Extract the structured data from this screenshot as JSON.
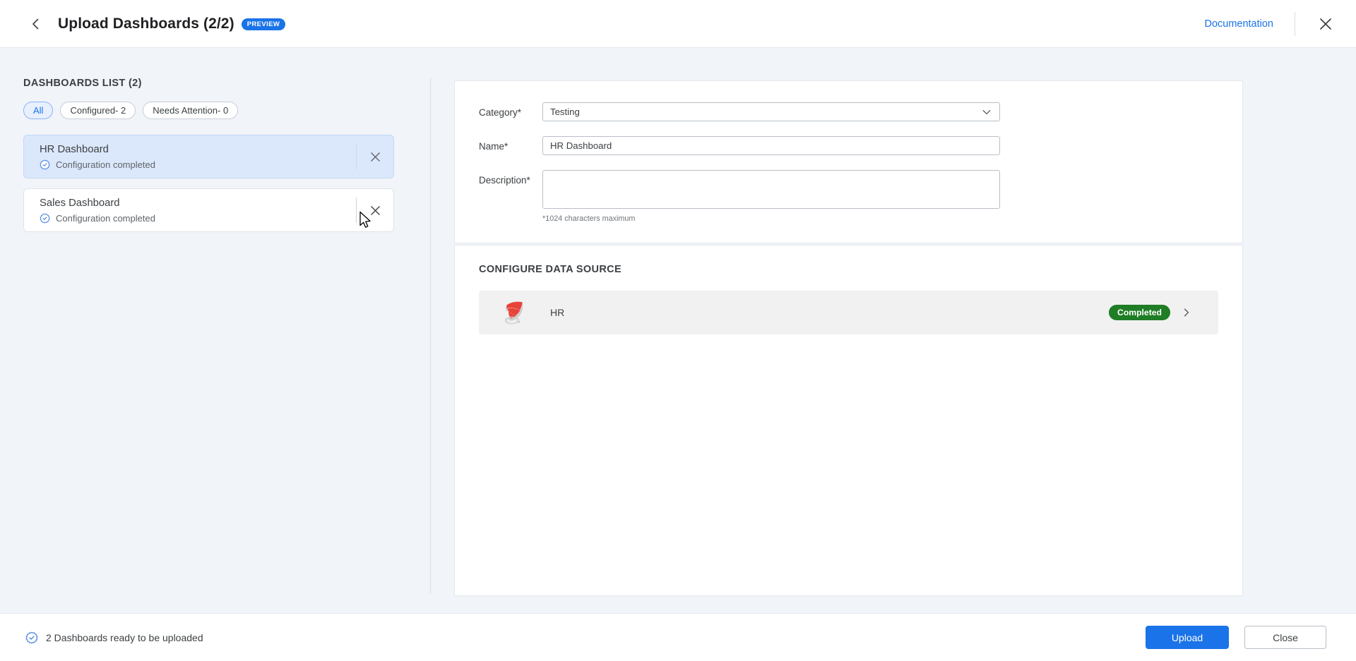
{
  "header": {
    "back_icon": "chevron-left-icon",
    "title": "Upload Dashboards (2/2)",
    "badge": "PREVIEW",
    "documentation_link": "Documentation",
    "close_icon": "close-icon"
  },
  "left": {
    "list_title": "DASHBOARDS LIST (2)",
    "filters": [
      {
        "label": "All",
        "active": true
      },
      {
        "label": "Configured- 2",
        "active": false
      },
      {
        "label": "Needs Attention- 0",
        "active": false
      }
    ],
    "dashboards": [
      {
        "name": "HR Dashboard",
        "status": "Configuration completed",
        "status_icon": "gear-check-icon",
        "remove_icon": "close-icon",
        "selected": true
      },
      {
        "name": "Sales Dashboard",
        "status": "Configuration completed",
        "status_icon": "gear-check-icon",
        "remove_icon": "close-icon",
        "selected": false
      }
    ]
  },
  "form": {
    "category_label": "Category*",
    "category_value": "Testing",
    "category_options": [
      "Testing"
    ],
    "name_label": "Name*",
    "name_value": "HR Dashboard",
    "name_placeholder": "",
    "description_label": "Description*",
    "description_value": "",
    "description_placeholder": "",
    "description_hint": "*1024 characters maximum"
  },
  "data_source": {
    "section_title": "CONFIGURE DATA SOURCE",
    "rows": [
      {
        "icon": "sql-server-icon",
        "name": "HR",
        "status": "Completed",
        "chevron": "chevron-right-icon"
      }
    ]
  },
  "footer": {
    "status_icon": "gear-check-icon",
    "status_text": "2 Dashboards ready to be uploaded",
    "upload_label": "Upload",
    "close_label": "Close"
  },
  "colors": {
    "accent": "#1a73e8",
    "success": "#1e7d25",
    "page_bg": "#f1f4f8",
    "selected_card": "#dbe8fb"
  }
}
